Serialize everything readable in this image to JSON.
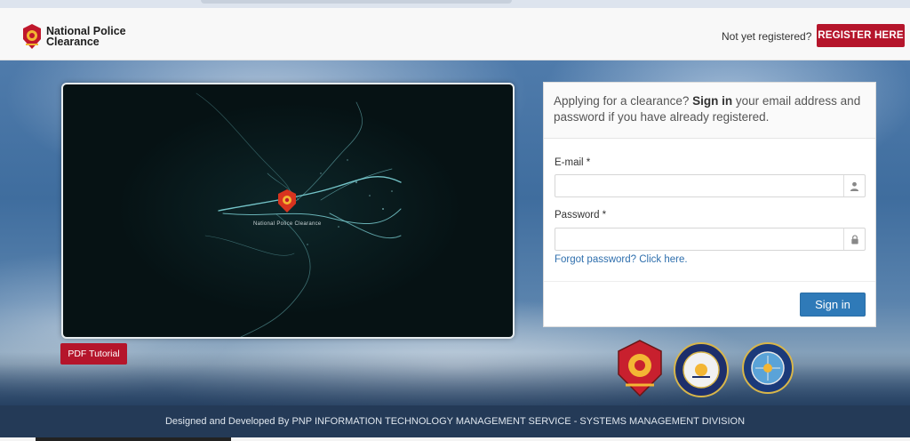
{
  "header": {
    "logo_line1": "National Police",
    "logo_line2": "Clearance",
    "not_registered": "Not yet registered?",
    "register_label": "REGISTER HERE"
  },
  "video": {
    "caption": "National Police Clearance"
  },
  "pdf_tutorial_label": "PDF Tutorial",
  "login": {
    "intro_prefix": "Applying for a clearance?",
    "intro_bold": "Sign in",
    "intro_suffix": "your email address and password if you have already registered.",
    "email_label": "E-mail *",
    "email_value": "",
    "password_label": "Password *",
    "password_value": "",
    "forgot_label": "Forgot password? Click here.",
    "signin_label": "Sign in"
  },
  "icons": {
    "email_addon": "user-icon",
    "password_addon": "lock-icon"
  },
  "colors": {
    "brand_red": "#b5152b",
    "signin_blue": "#2f7ab8",
    "link_blue": "#2f6fad",
    "footer_bg": "#243a57"
  },
  "footer": {
    "text": "Designed and Developed By PNP INFORMATION TECHNOLOGY MANAGEMENT SERVICE - SYSTEMS MANAGEMENT DIVISION"
  }
}
